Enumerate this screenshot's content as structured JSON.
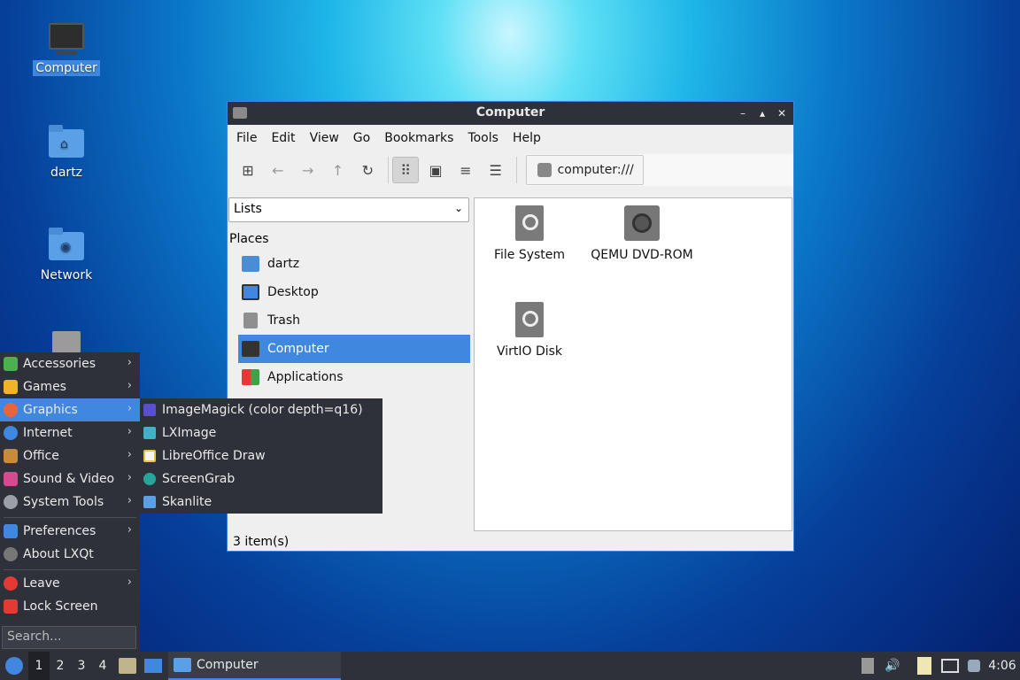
{
  "desktop": {
    "icons": [
      {
        "label": "Computer"
      },
      {
        "label": "dartz"
      },
      {
        "label": "Network"
      }
    ]
  },
  "window": {
    "title": "Computer",
    "controls": {
      "minimize": "–",
      "maximize": "▴",
      "close": "✕"
    },
    "menubar": [
      "File",
      "Edit",
      "View",
      "Go",
      "Bookmarks",
      "Tools",
      "Help"
    ],
    "address": "computer:///",
    "side_pane_mode": "Lists",
    "places_heading": "Places",
    "places": [
      {
        "label": "dartz",
        "color": "#4a8dd4"
      },
      {
        "label": "Desktop",
        "color": "#3f87df"
      },
      {
        "label": "Trash",
        "color": "#8f8f8f"
      },
      {
        "label": "Computer",
        "color": "#333333"
      },
      {
        "label": "Applications",
        "color": "#e8a33c"
      }
    ],
    "items": [
      {
        "label": "File System",
        "icon": "drive-icon"
      },
      {
        "label": "QEMU DVD-ROM",
        "icon": "dvd-icon"
      },
      {
        "label": "VirtIO Disk",
        "icon": "drive-icon"
      }
    ],
    "status": "3 item(s)"
  },
  "menu": {
    "items": [
      {
        "label": "Accessories",
        "color": "#4caf50"
      },
      {
        "label": "Games",
        "color": "#f0b429"
      },
      {
        "label": "Graphics",
        "color": "#e8643c"
      },
      {
        "label": "Internet",
        "color": "#3f87df"
      },
      {
        "label": "Office",
        "color": "#c98b3a"
      },
      {
        "label": "Sound & Video",
        "color": "#d84a8f"
      },
      {
        "label": "System Tools",
        "color": "#9aa0a6"
      },
      {
        "label": "Preferences",
        "color": "#3f87df"
      },
      {
        "label": "About LXQt",
        "color": "#777777"
      },
      {
        "label": "Leave",
        "color": "#e53935"
      },
      {
        "label": "Lock Screen",
        "color": "#e53935"
      }
    ],
    "search_placeholder": "Search..."
  },
  "submenu": {
    "items": [
      {
        "label": "ImageMagick (color depth=q16)",
        "color": "#5a4fcf"
      },
      {
        "label": "LXImage",
        "color": "#3fb2c9"
      },
      {
        "label": "LibreOffice Draw",
        "color": "#e8c23c"
      },
      {
        "label": "ScreenGrab",
        "color": "#26a69a"
      },
      {
        "label": "Skanlite",
        "color": "#5aa0e6"
      }
    ]
  },
  "taskbar": {
    "workspaces": [
      "1",
      "2",
      "3",
      "4"
    ],
    "active_window": "Computer",
    "clock": "4:06"
  },
  "colors": {
    "accent": "#3f87df",
    "panel": "#2e3139"
  }
}
